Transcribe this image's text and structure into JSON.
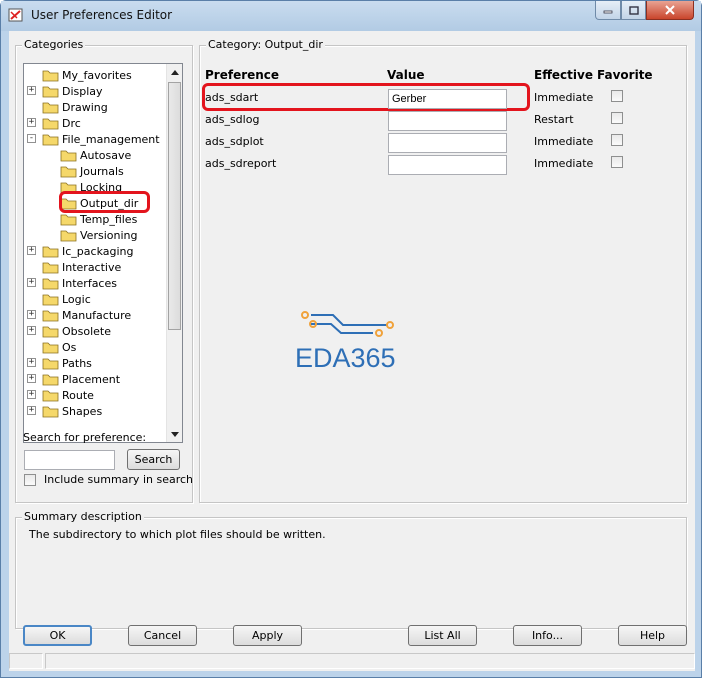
{
  "window": {
    "title": "User Preferences Editor"
  },
  "categories": {
    "group_label": "Categories",
    "items": [
      {
        "label": "My_favorites",
        "depth": 0,
        "expander": ""
      },
      {
        "label": "Display",
        "depth": 0,
        "expander": "+"
      },
      {
        "label": "Drawing",
        "depth": 0,
        "expander": ""
      },
      {
        "label": "Drc",
        "depth": 0,
        "expander": "+"
      },
      {
        "label": "File_management",
        "depth": 0,
        "expander": "-"
      },
      {
        "label": "Autosave",
        "depth": 1,
        "expander": ""
      },
      {
        "label": "Journals",
        "depth": 1,
        "expander": ""
      },
      {
        "label": "Locking",
        "depth": 1,
        "expander": ""
      },
      {
        "label": "Output_dir",
        "depth": 1,
        "expander": "",
        "selected": true
      },
      {
        "label": "Temp_files",
        "depth": 1,
        "expander": ""
      },
      {
        "label": "Versioning",
        "depth": 1,
        "expander": ""
      },
      {
        "label": "Ic_packaging",
        "depth": 0,
        "expander": "+"
      },
      {
        "label": "Interactive",
        "depth": 0,
        "expander": ""
      },
      {
        "label": "Interfaces",
        "depth": 0,
        "expander": "+"
      },
      {
        "label": "Logic",
        "depth": 0,
        "expander": ""
      },
      {
        "label": "Manufacture",
        "depth": 0,
        "expander": "+"
      },
      {
        "label": "Obsolete",
        "depth": 0,
        "expander": "+"
      },
      {
        "label": "Os",
        "depth": 0,
        "expander": ""
      },
      {
        "label": "Paths",
        "depth": 0,
        "expander": "+"
      },
      {
        "label": "Placement",
        "depth": 0,
        "expander": "+"
      },
      {
        "label": "Route",
        "depth": 0,
        "expander": "+"
      },
      {
        "label": "Shapes",
        "depth": 0,
        "expander": "+"
      }
    ]
  },
  "search": {
    "label": "Search for preference:",
    "value": "",
    "button_label": "Search",
    "include_summary_label": "Include summary in search",
    "include_summary_checked": false
  },
  "category_panel": {
    "group_label": "Category:  Output_dir",
    "headers": {
      "preference": "Preference",
      "value": "Value",
      "effective": "Effective",
      "favorite": "Favorite"
    },
    "rows": [
      {
        "preference": "ads_sdart",
        "value": "Gerber",
        "effective": "Immediate",
        "favorite": false
      },
      {
        "preference": "ads_sdlog",
        "value": "",
        "effective": "Restart",
        "favorite": false
      },
      {
        "preference": "ads_sdplot",
        "value": "",
        "effective": "Immediate",
        "favorite": false
      },
      {
        "preference": "ads_sdreport",
        "value": "",
        "effective": "Immediate",
        "favorite": false
      }
    ]
  },
  "watermark": {
    "text": "EDA365",
    "color": "#2e6fb6",
    "accent": "#f0a23b"
  },
  "summary": {
    "group_label": "Summary description",
    "text": "The subdirectory to which plot files should be written."
  },
  "buttons": {
    "ok": "OK",
    "cancel": "Cancel",
    "apply": "Apply",
    "list_all": "List All",
    "info": "Info...",
    "help": "Help"
  },
  "colors": {
    "highlight_box": "#e3141d",
    "folder_yellow": "#f5d86a"
  }
}
